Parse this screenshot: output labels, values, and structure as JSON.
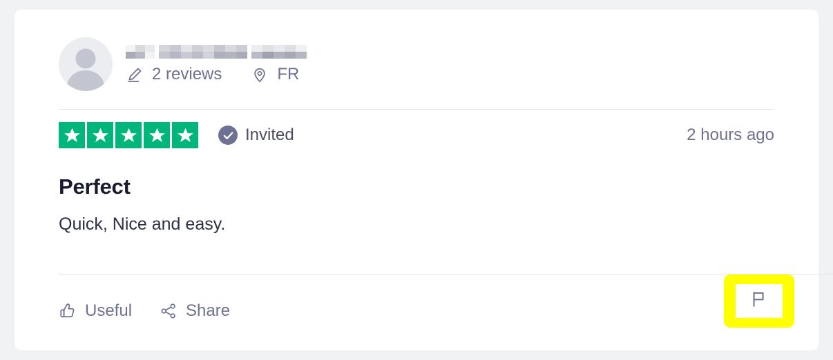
{
  "card": {
    "consumer": {
      "avatar_name": "default-avatar",
      "name_redacted": true,
      "reviews_count_label": "2 reviews",
      "location_label": "FR"
    },
    "rating": {
      "value": 5,
      "max": 5,
      "star_color": "#00b67a",
      "stars_aria": "Rated 5 out of 5 stars"
    },
    "invited": {
      "label": "Invited",
      "badge_color": "#6e7191"
    },
    "timestamp": "2 hours ago",
    "review": {
      "title": "Perfect",
      "text": "Quick, Nice and easy."
    },
    "actions": [
      {
        "id": "useful",
        "label": "Useful",
        "icon": "thumbs-up-icon"
      },
      {
        "id": "share",
        "label": "Share",
        "icon": "share-nodes-icon"
      }
    ],
    "report": {
      "icon": "flag-icon",
      "highlight_color": "#ffff00"
    }
  },
  "theme": {
    "page_background": "#f1f2f4",
    "card_background": "#ffffff",
    "divider_color": "#e3e5e9",
    "text_muted": "#6e7191",
    "text_dark": "#1b1b2f"
  }
}
